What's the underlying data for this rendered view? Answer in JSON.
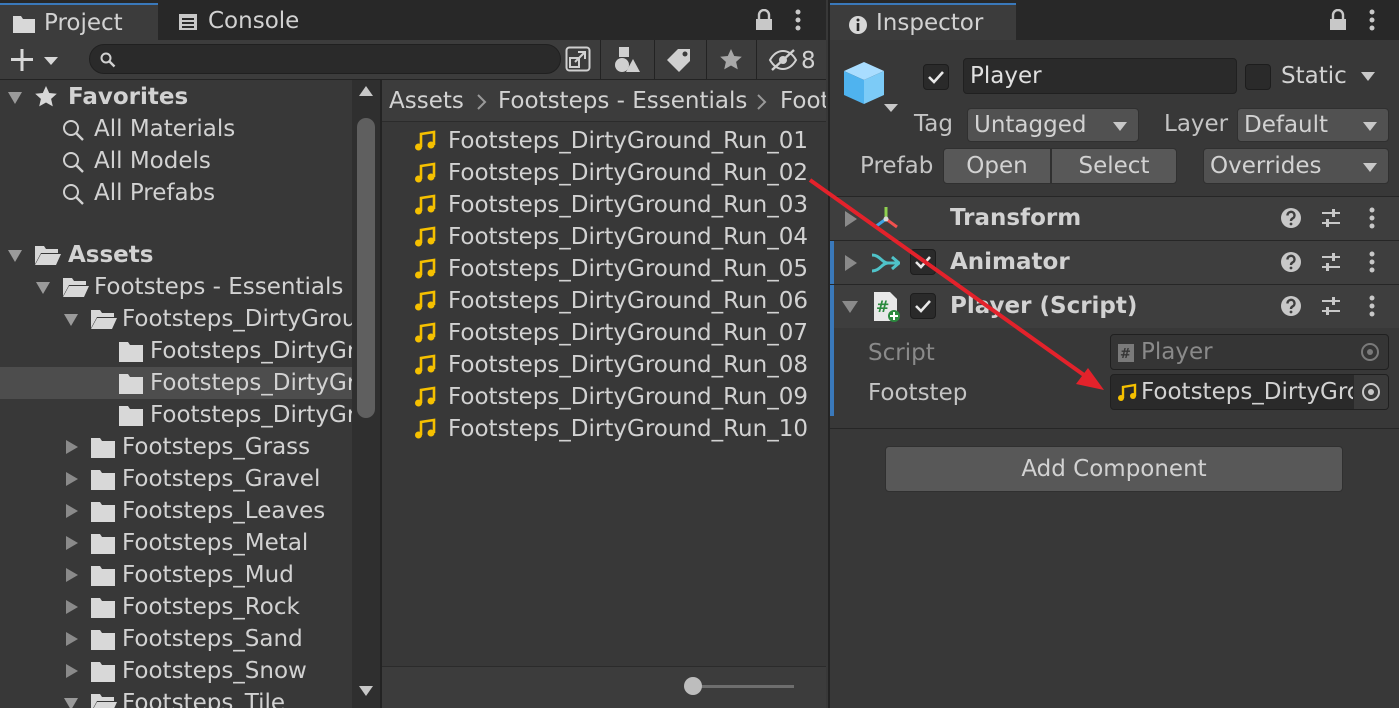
{
  "project": {
    "tabs": [
      {
        "label": "Project"
      },
      {
        "label": "Console"
      }
    ],
    "toolbar": {
      "hidden_count": "8"
    },
    "search": {
      "placeholder": ""
    },
    "tree": {
      "favorites": {
        "label": "Favorites",
        "items": [
          "All Materials",
          "All Models",
          "All Prefabs"
        ]
      },
      "assets": {
        "label": "Assets",
        "folders": [
          "Footsteps - Essentials",
          "Footsteps_DirtyGrou",
          "Footsteps_DirtyGr",
          "Footsteps_DirtyGr",
          "Footsteps_DirtyGr",
          "Footsteps_Grass",
          "Footsteps_Gravel",
          "Footsteps_Leaves",
          "Footsteps_Metal",
          "Footsteps_Mud",
          "Footsteps_Rock",
          "Footsteps_Sand",
          "Footsteps_Snow",
          "Footsteps_Tile"
        ]
      }
    },
    "breadcrumb": [
      "Assets",
      "Footsteps - Essentials",
      "Foot"
    ],
    "files": [
      "Footsteps_DirtyGround_Run_01",
      "Footsteps_DirtyGround_Run_02",
      "Footsteps_DirtyGround_Run_03",
      "Footsteps_DirtyGround_Run_04",
      "Footsteps_DirtyGround_Run_05",
      "Footsteps_DirtyGround_Run_06",
      "Footsteps_DirtyGround_Run_07",
      "Footsteps_DirtyGround_Run_08",
      "Footsteps_DirtyGround_Run_09",
      "Footsteps_DirtyGround_Run_10"
    ],
    "zoom_slider": {
      "value": 0.0
    }
  },
  "inspector": {
    "tab": "Inspector",
    "object": {
      "name": "Player",
      "static_label": "Static",
      "active": true,
      "static": false
    },
    "tag": {
      "label": "Tag",
      "value": "Untagged"
    },
    "layer": {
      "label": "Layer",
      "value": "Default"
    },
    "prefab": {
      "label": "Prefab",
      "open": "Open",
      "select": "Select",
      "overrides": "Overrides"
    },
    "components": [
      {
        "name": "Transform",
        "expanded": false,
        "has_checkbox": false
      },
      {
        "name": "Animator",
        "expanded": false,
        "has_checkbox": true,
        "enabled": true
      },
      {
        "name": "Player (Script)",
        "expanded": true,
        "has_checkbox": true,
        "enabled": true
      }
    ],
    "script_fields": {
      "script": {
        "label": "Script",
        "value": "Player"
      },
      "footstep": {
        "label": "Footstep",
        "value": "Footsteps_DirtyGrc"
      }
    },
    "add_component": "Add Component"
  },
  "colors": {
    "panel_bg": "#383838",
    "selection": "#4d4d4d",
    "accent_blue": "#3a79bb",
    "audio_icon": "#f5c000",
    "annotation_arrow": "#e3222b"
  }
}
